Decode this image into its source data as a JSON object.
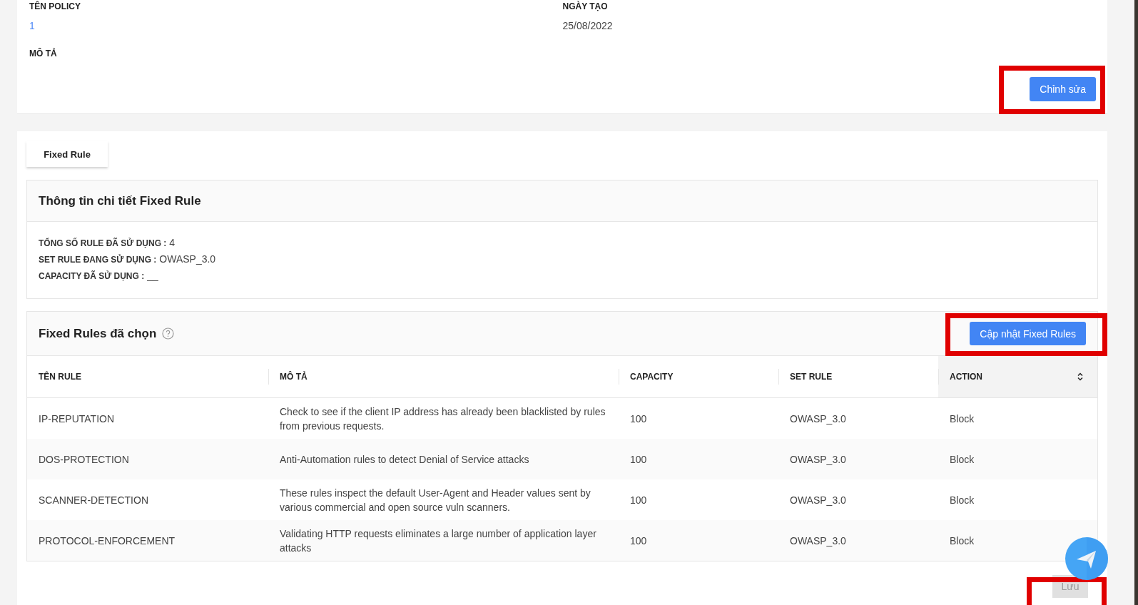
{
  "policy": {
    "name_label": "TÊN POLICY",
    "name": "1",
    "created_label": "NGÀY TẠO",
    "created": "25/08/2022",
    "description_label": "MÔ TẢ"
  },
  "edit_button": {
    "label": "Chỉnh sửa"
  },
  "tabs": [
    {
      "label": "Fixed Rule",
      "selected": true
    }
  ],
  "detail": {
    "title": "Thông tin chi tiết Fixed Rule",
    "items": [
      {
        "label": "TỔNG SỐ RULE ĐÃ SỬ DỤNG :",
        "value": "4"
      },
      {
        "label": "SET RULE ĐANG SỬ DỤNG :",
        "value": "OWASP_3.0"
      },
      {
        "label": "CAPACITY ĐÃ SỬ DỤNG :",
        "value": "__"
      }
    ]
  },
  "selected_rules": {
    "title": "Fixed Rules đã chọn",
    "update_button": "Cập nhật Fixed Rules",
    "columns": [
      {
        "label": "TÊN RULE",
        "sortable": false
      },
      {
        "label": "MÔ TẢ",
        "sortable": false
      },
      {
        "label": "CAPACITY",
        "sortable": false
      },
      {
        "label": "SET RULE",
        "sortable": false
      },
      {
        "label": "ACTION",
        "sortable": true
      }
    ],
    "rows": [
      [
        "IP-REPUTATION",
        "Check to see if the client IP address has already been blacklisted by rules from previous requests.",
        "100",
        "OWASP_3.0",
        "Block"
      ],
      [
        "DOS-PROTECTION",
        "Anti-Automation rules to detect Denial of Service attacks",
        "100",
        "OWASP_3.0",
        "Block"
      ],
      [
        "SCANNER-DETECTION",
        "These rules inspect the default User-Agent and Header values sent by various commercial and open source vuln scanners.",
        "100",
        "OWASP_3.0",
        "Block"
      ],
      [
        "PROTOCOL-ENFORCEMENT",
        "Validating HTTP requests eliminates a large number of application layer attacks",
        "100",
        "OWASP_3.0",
        "Block"
      ]
    ]
  },
  "save_button": {
    "label": "Lưu",
    "disabled": true
  }
}
